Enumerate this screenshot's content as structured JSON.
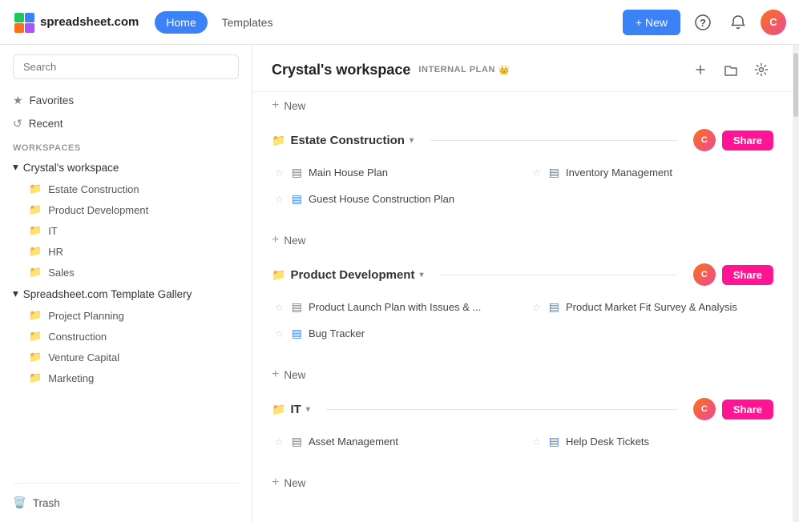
{
  "header": {
    "logo_text": "spreadsheet.com",
    "nav": [
      {
        "label": "Home",
        "active": true
      },
      {
        "label": "Templates",
        "active": false
      }
    ],
    "new_button": "+ New",
    "avatar_text": "C"
  },
  "sidebar": {
    "search_placeholder": "Search",
    "favorites_label": "Favorites",
    "recent_label": "Recent",
    "workspaces_label": "WORKSPACES",
    "workspaces": [
      {
        "name": "Crystal's workspace",
        "expanded": true,
        "items": [
          "Estate Construction",
          "Product Development",
          "IT",
          "HR",
          "Sales"
        ]
      },
      {
        "name": "Spreadsheet.com Template Gallery",
        "expanded": true,
        "items": [
          "Project Planning",
          "Construction",
          "Venture Capital",
          "Marketing"
        ]
      }
    ],
    "trash_label": "Trash"
  },
  "content": {
    "workspace_title": "Crystal's workspace",
    "plan_label": "INTERNAL PLAN",
    "plan_emoji": "👑",
    "sections": [
      {
        "type": "new",
        "label": "New"
      },
      {
        "type": "folder",
        "name": "Estate Construction",
        "sheets": [
          {
            "name": "Main House Plan",
            "starred": false
          },
          {
            "name": "Inventory Management",
            "starred": false
          },
          {
            "name": "Guest House Construction Plan",
            "starred": false
          }
        ],
        "new_label": "New"
      },
      {
        "type": "folder",
        "name": "Product Development",
        "sheets": [
          {
            "name": "Product Launch Plan with Issues & ...",
            "starred": false
          },
          {
            "name": "Product Market Fit Survey & Analysis",
            "starred": false
          },
          {
            "name": "Bug Tracker",
            "starred": false
          }
        ],
        "new_label": "New"
      },
      {
        "type": "folder",
        "name": "IT",
        "sheets": [
          {
            "name": "Asset Management",
            "starred": false
          },
          {
            "name": "Help Desk Tickets",
            "starred": false
          }
        ],
        "new_label": "New"
      }
    ]
  }
}
